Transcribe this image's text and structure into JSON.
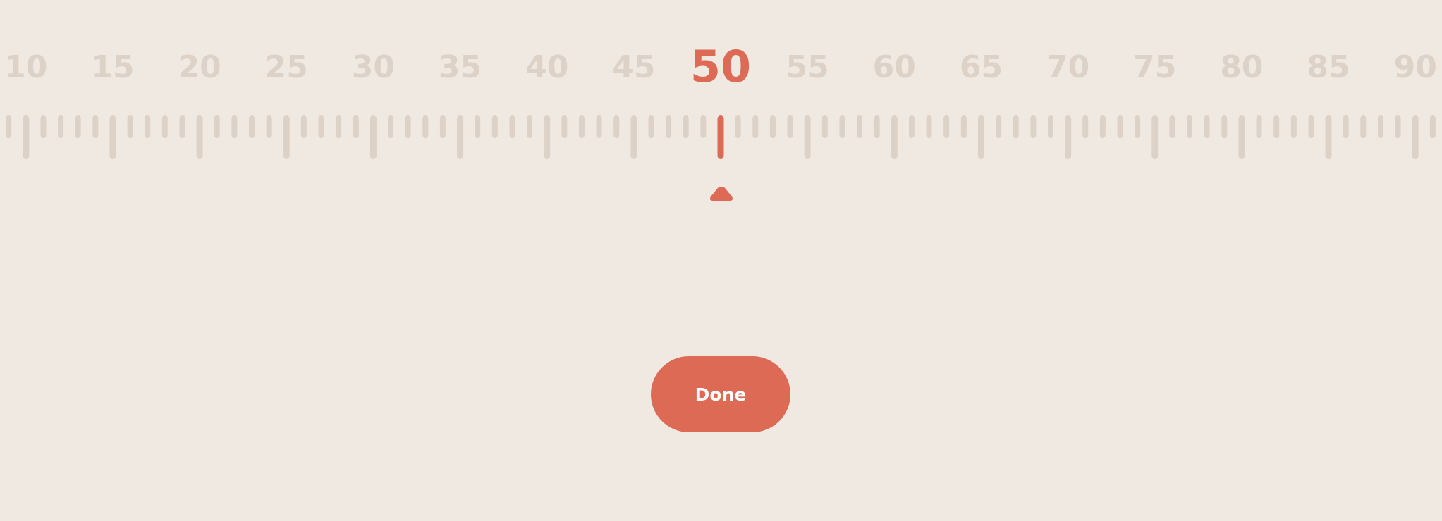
{
  "ruler": {
    "min": 10,
    "max": 90,
    "step": 1,
    "label_interval": 5,
    "selected_value": 50,
    "labels": [
      "10",
      "15",
      "20",
      "25",
      "30",
      "35",
      "40",
      "45",
      "50",
      "55",
      "60",
      "65",
      "70",
      "75",
      "80",
      "85",
      "90"
    ]
  },
  "done_button": {
    "label": "Done"
  },
  "colors": {
    "background": "#f0e9e1",
    "tick": "#ddd2c7",
    "accent": "#dc6a55",
    "button_text": "#ffffff"
  },
  "icons": {
    "pointer": "caret-up-icon"
  }
}
